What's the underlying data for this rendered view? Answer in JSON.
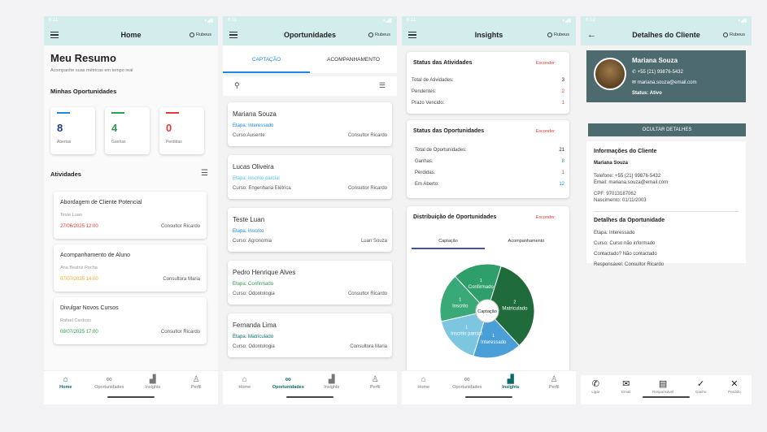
{
  "status_times": [
    "6:11",
    "6:11",
    "6:11",
    "6:12"
  ],
  "rubeus_label": "Rubeus",
  "colors": {
    "teal": "#0b6b6b",
    "appbar": "#d3ecec",
    "blue": "#1e88e5",
    "green": "#2e9e4e",
    "red": "#e53935",
    "orange": "#f5a623"
  },
  "home": {
    "title": "Home",
    "heading": "Meu Resumo",
    "subtitle": "Acompanhe suas métricas em tempo real",
    "opp_section": "Minhas Oportunidades",
    "stats": [
      {
        "value": "8",
        "label": "Abertas",
        "color": "#1e88e5"
      },
      {
        "value": "4",
        "label": "Ganhas",
        "color": "#2e9e4e"
      },
      {
        "value": "0",
        "label": "Perdidas",
        "color": "#e53935"
      }
    ],
    "activities_section": "Atividades",
    "activities": [
      {
        "title": "Abordagem de Cliente Potencial",
        "person": "Teste Luan",
        "date": "27/06/2025 12:00",
        "date_color": "#e53935",
        "consultant": "Consultor Ricardo"
      },
      {
        "title": "Acompanhamento de Aluno",
        "person": "Ana Beatriz Rocha",
        "date": "07/07/2025 14:00",
        "date_color": "#f5a623",
        "consultant": "Consultora Maria"
      },
      {
        "title": "Divulgar Novos Cursos",
        "person": "Rafael Cardoso",
        "date": "09/07/2025 17:00",
        "date_color": "#2e9e4e",
        "consultant": "Consultor Ricardo"
      }
    ]
  },
  "nav": [
    "Home",
    "Oportunidades",
    "Insights",
    "Perfil"
  ],
  "opportunities": {
    "title": "Oportunidades",
    "tabs": [
      "CAPTAÇÃO",
      "ACOMPANHAMENTO"
    ],
    "items": [
      {
        "name": "Mariana Souza",
        "stage": "Etapa: Interessado",
        "stage_color": "#1e88e5",
        "course": "Curso:Ausente",
        "consultant": "Consultor Ricardo"
      },
      {
        "name": "Lucas Oliveira",
        "stage": "Etapa: Inscrito parcial",
        "stage_color": "#4fc3f7",
        "course": "Curso: Engenharia Elétrica",
        "consultant": "Consultor Ricardo"
      },
      {
        "name": "Teste Luan",
        "stage": "Etapa: Inscrito",
        "stage_color": "#1e88e5",
        "course": "Curso: Agronomia",
        "consultant": "Luan Souza"
      },
      {
        "name": "Pedro Henrique Alves",
        "stage": "Etapa: Confirmado",
        "stage_color": "#2e9e4e",
        "course": "Curso: Odontologia",
        "consultant": "Consultor Ricardo"
      },
      {
        "name": "Fernanda Lima",
        "stage": "Etapa: Matriculado",
        "stage_color": "#0b6b6b",
        "course": "Curso: Odontologia",
        "consultant": "Consultora Maria"
      }
    ]
  },
  "insights": {
    "title": "Insights",
    "hide_label": "Esconder",
    "activities_status": {
      "title": "Status das Atividades",
      "rows": [
        {
          "label": "Total de Atividades:",
          "value": "3",
          "color": "#222"
        },
        {
          "label": "Pendentes:",
          "value": "2",
          "color": "#e53935"
        },
        {
          "label": "Prazo Vencido:",
          "value": "1",
          "color": "#e53935"
        }
      ]
    },
    "opp_status": {
      "title": "Status das Oportunidades",
      "rows": [
        {
          "label": "Total de Oportunidades:",
          "value": "21",
          "color": "#222"
        },
        {
          "label": "Ganhas:",
          "value": "8",
          "color": "#2e9e4e"
        },
        {
          "label": "Perdidas:",
          "value": "1",
          "color": "#e53935"
        },
        {
          "label": "Em Aberto:",
          "value": "12",
          "color": "#1e88e5"
        }
      ]
    },
    "distribution": {
      "title": "Distribuição de Oportunidades",
      "tabs": [
        "Captação",
        "Acompanhamento"
      ],
      "center_label": "Captação"
    }
  },
  "chart_data": {
    "type": "pie",
    "title": "Distribuição de Oportunidades",
    "categories": [
      "Matriculado",
      "Interessado",
      "Inscrito parcial",
      "Inscrito",
      "Confirmado"
    ],
    "values": [
      2,
      1,
      1,
      1,
      1
    ],
    "colors": [
      "#1f6b3c",
      "#4a9fd8",
      "#7cc6df",
      "#3aa978",
      "#2e9e6a"
    ]
  },
  "details": {
    "title": "Detalhes do Cliente",
    "name": "Mariana Souza",
    "phone": "+55 (21) 99876-5432",
    "email": "mariana.souza@email.com",
    "status": "Status: Ativo",
    "hide_button": "OCULTAR DETALHES",
    "client_info_title": "Informações do Cliente",
    "client_name": "Mariana Souza",
    "phone_line": "Telefone: +55 (21) 99876-5432",
    "email_line": "Email: mariana.souza@email.com",
    "cpf_line": "CPF: 97013187062",
    "birth_line": "Nascimento: 01/11/2003",
    "opp_details_title": "Detalhes da Oportunidade",
    "stage_line": "Etapa: Interessado",
    "course_line": "Curso: Curso não informado",
    "contacted_line": "Contactado? Não contactado",
    "responsible_line": "Responsável: Consultor Ricardo",
    "actions": [
      "Ligar",
      "Email",
      "Responsável",
      "Ganho",
      "Perdido"
    ]
  }
}
